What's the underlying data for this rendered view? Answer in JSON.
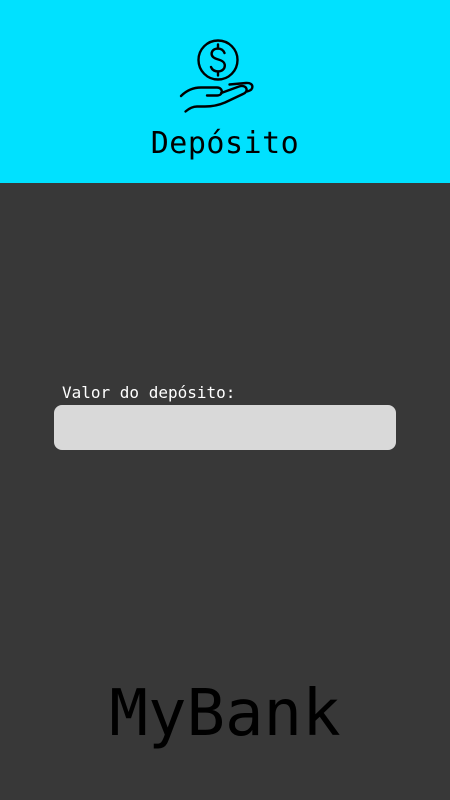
{
  "colors": {
    "header_bg": "#00e1ff",
    "page_bg": "#383838",
    "input_bg": "#d9d9d9"
  },
  "header": {
    "icon": "hand-holding-dollar-icon",
    "title": "Depósito"
  },
  "deposit_form": {
    "label": "Valor do depósito:",
    "value": "",
    "placeholder": ""
  },
  "brand": {
    "name": "MyBank"
  }
}
